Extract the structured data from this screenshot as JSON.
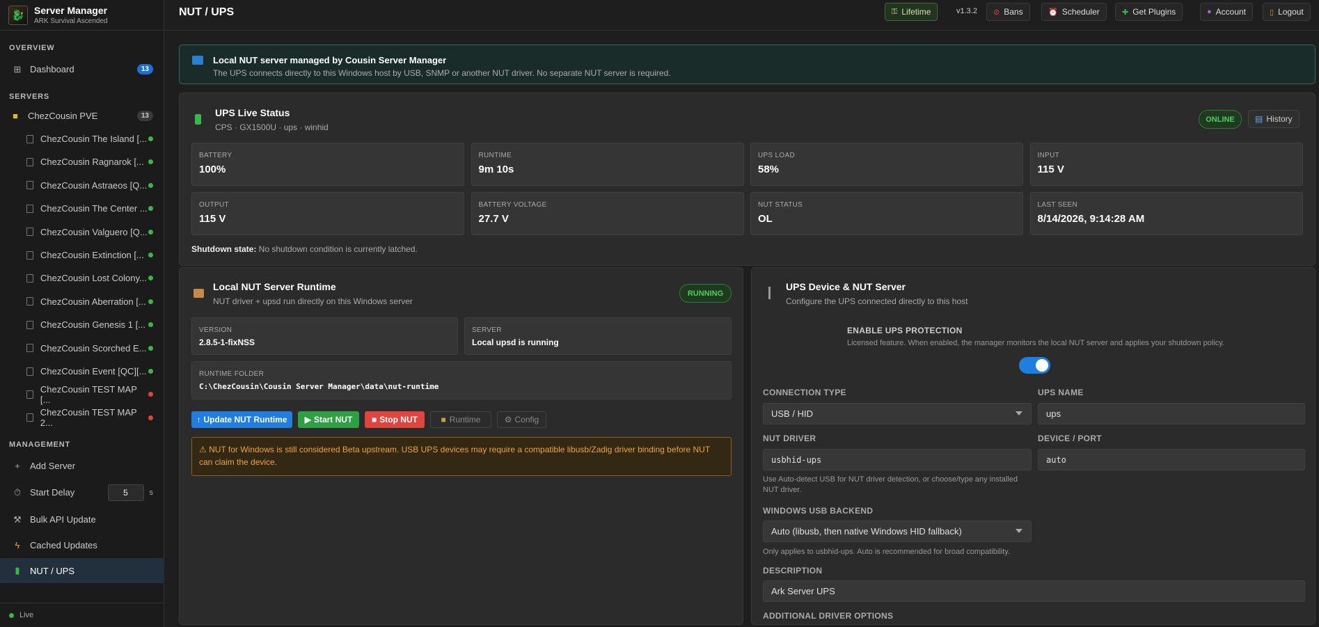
{
  "app": {
    "title": "Server Manager",
    "subtitle": "ARK Survival Ascended"
  },
  "sidebar": {
    "overview_label": "OVERVIEW",
    "dashboard": {
      "label": "Dashboard",
      "count": "13"
    },
    "servers_label": "SERVERS",
    "group": {
      "label": "ChezCousin PVE",
      "count": "13"
    },
    "servers": [
      {
        "name": "ChezCousin The Island [...",
        "status": "online"
      },
      {
        "name": "ChezCousin Ragnarok [...",
        "status": "online"
      },
      {
        "name": "ChezCousin Astraeos [Q...",
        "status": "online"
      },
      {
        "name": "ChezCousin The Center ...",
        "status": "online"
      },
      {
        "name": "ChezCousin Valguero [Q...",
        "status": "online"
      },
      {
        "name": "ChezCousin Extinction [...",
        "status": "online"
      },
      {
        "name": "ChezCousin Lost Colony...",
        "status": "online"
      },
      {
        "name": "ChezCousin Aberration [...",
        "status": "online"
      },
      {
        "name": "ChezCousin Genesis 1 [...",
        "status": "online"
      },
      {
        "name": "ChezCousin Scorched E...",
        "status": "online"
      },
      {
        "name": "ChezCousin Event [QC][...",
        "status": "online"
      },
      {
        "name": "ChezCousin TEST MAP [...",
        "status": "offline"
      },
      {
        "name": "ChezCousin TEST MAP 2...",
        "status": "offline"
      }
    ],
    "management_label": "MANAGEMENT",
    "add_server": "Add Server",
    "start_delay": {
      "label": "Start Delay",
      "value": "5",
      "suffix": "s"
    },
    "bulk_api": "Bulk API Update",
    "cached_updates": "Cached Updates",
    "nut_ups": "NUT / UPS",
    "footer_status": "Live"
  },
  "colors": {
    "online": "#3cb64a",
    "offline": "#e0443e",
    "accent": "#1f7ee0"
  },
  "topbar": {
    "page_title": "NUT / UPS",
    "lifetime": "Lifetime",
    "version": "v1.3.2",
    "bans": "Bans",
    "scheduler": "Scheduler",
    "get_plugins": "Get Plugins",
    "account": "Account",
    "logout": "Logout"
  },
  "banner": {
    "title": "Local NUT server managed by Cousin Server Manager",
    "text": "The UPS connects directly to this Windows host by USB, SNMP or another NUT driver. No separate NUT server is required."
  },
  "live": {
    "title": "UPS Live Status",
    "subtitle": "CPS · GX1500U · ups · winhid",
    "status_badge": "ONLINE",
    "history_btn": "History",
    "cards": [
      {
        "label": "BATTERY",
        "value": "100%"
      },
      {
        "label": "RUNTIME",
        "value": "9m 10s"
      },
      {
        "label": "UPS LOAD",
        "value": "58%"
      },
      {
        "label": "INPUT",
        "value": "115 V"
      },
      {
        "label": "OUTPUT",
        "value": "115 V"
      },
      {
        "label": "BATTERY VOLTAGE",
        "value": "27.7 V"
      },
      {
        "label": "NUT STATUS",
        "value": "OL"
      },
      {
        "label": "LAST SEEN",
        "value": "8/14/2026, 9:14:28 AM"
      }
    ],
    "shutdown_label": "Shutdown state:",
    "shutdown_text": "No shutdown condition is currently latched."
  },
  "runtime": {
    "title": "Local NUT Server Runtime",
    "subtitle": "NUT driver + upsd run directly on this Windows server",
    "status_badge": "RUNNING",
    "version_label": "VERSION",
    "version": "2.8.5-1-fixNSS",
    "server_label": "SERVER",
    "server": "Local upsd is running",
    "folder_label": "RUNTIME FOLDER",
    "folder": "C:\\ChezCousin\\Cousin Server Manager\\data\\nut-runtime",
    "btn_update": "Update NUT Runtime",
    "btn_start": "Start NUT",
    "btn_stop": "Stop NUT",
    "btn_runtime": "Runtime",
    "btn_config": "Config",
    "warning": "⚠ NUT for Windows is still considered Beta upstream. USB UPS devices may require a compatible libusb/Zadig driver binding before NUT can claim the device."
  },
  "device": {
    "title": "UPS Device & NUT Server",
    "subtitle": "Configure the UPS connected directly to this host",
    "enable_label": "ENABLE UPS PROTECTION",
    "enable_help": "Licensed feature. When enabled, the manager monitors the local NUT server and applies your shutdown policy.",
    "enabled": true,
    "conn_label": "CONNECTION TYPE",
    "conn_value": "USB / HID",
    "name_label": "UPS NAME",
    "name_value": "ups",
    "driver_label": "NUT DRIVER",
    "driver_value": "usbhid-ups",
    "port_label": "DEVICE / PORT",
    "port_value": "auto",
    "driver_help": "Use Auto-detect USB for NUT driver detection, or choose/type any installed NUT driver.",
    "backend_label": "WINDOWS USB BACKEND",
    "backend_value": "Auto (libusb, then native Windows HID fallback)",
    "backend_help": "Only applies to usbhid-ups. Auto is recommended for broad compatibility.",
    "desc_label": "DESCRIPTION",
    "desc_value": "Ark Server UPS",
    "extra_label": "ADDITIONAL DRIVER OPTIONS"
  }
}
